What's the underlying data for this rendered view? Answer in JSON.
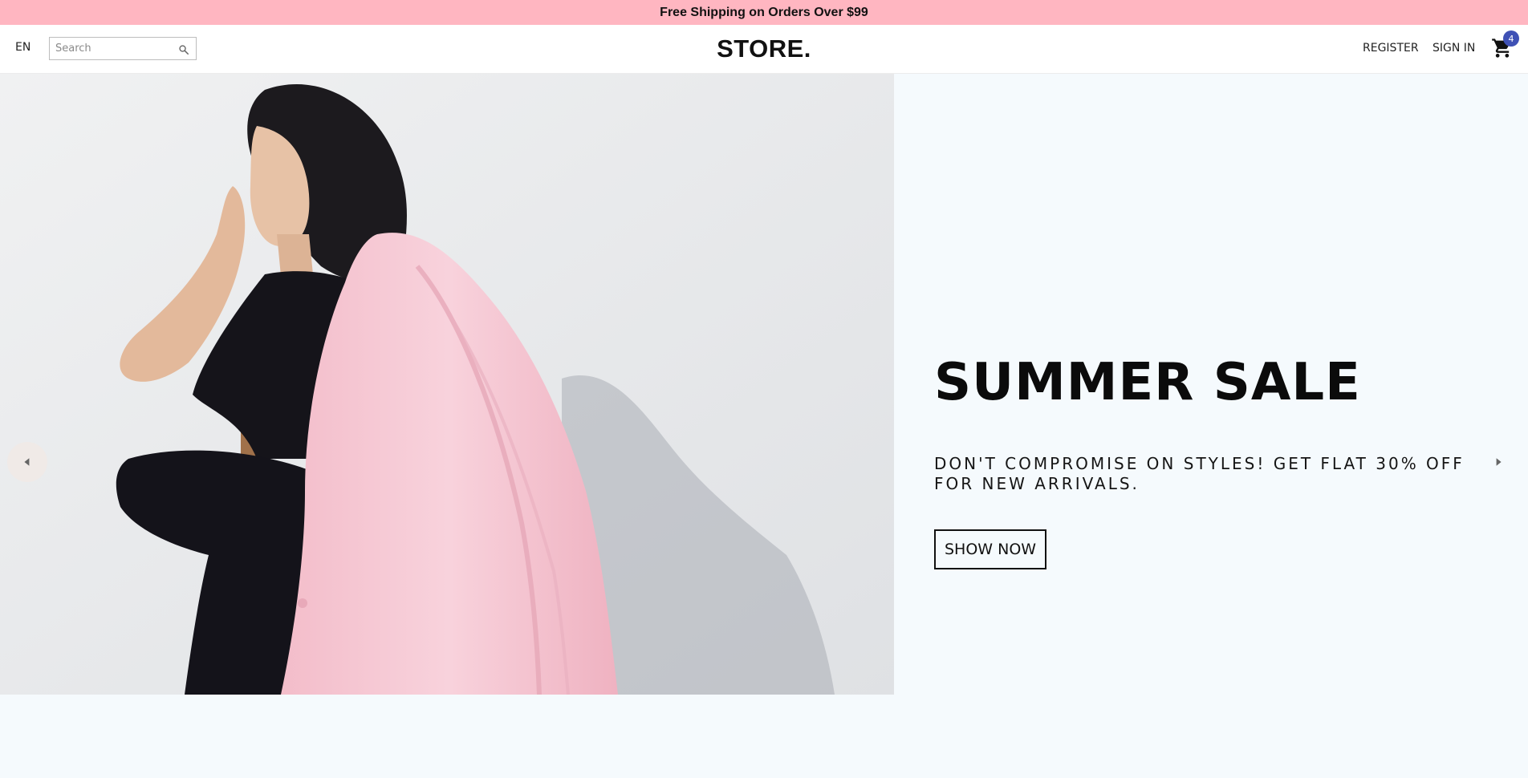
{
  "announcement": {
    "text": "Free Shipping on Orders Over $99"
  },
  "header": {
    "language": "EN",
    "search": {
      "placeholder": "Search",
      "value": ""
    },
    "logo": "STORE.",
    "register_label": "REGISTER",
    "signin_label": "SIGN IN",
    "cart_count": "4"
  },
  "slider": {
    "title": "SUMMER SALE",
    "subtitle": "DON'T COMPROMISE ON STYLES! GET FLAT 30% OFF FOR NEW ARRIVALS.",
    "button_label": "SHOW NOW"
  },
  "icons": {
    "search": "search-icon",
    "cart": "shopping-cart-icon",
    "prev": "arrow-left-icon",
    "next": "arrow-right-icon"
  },
  "colors": {
    "announcement_bg": "#ffb6c1",
    "hero_bg": "#f5fafd",
    "cart_badge": "#3f51b5",
    "coat": "#f7c9d4"
  }
}
